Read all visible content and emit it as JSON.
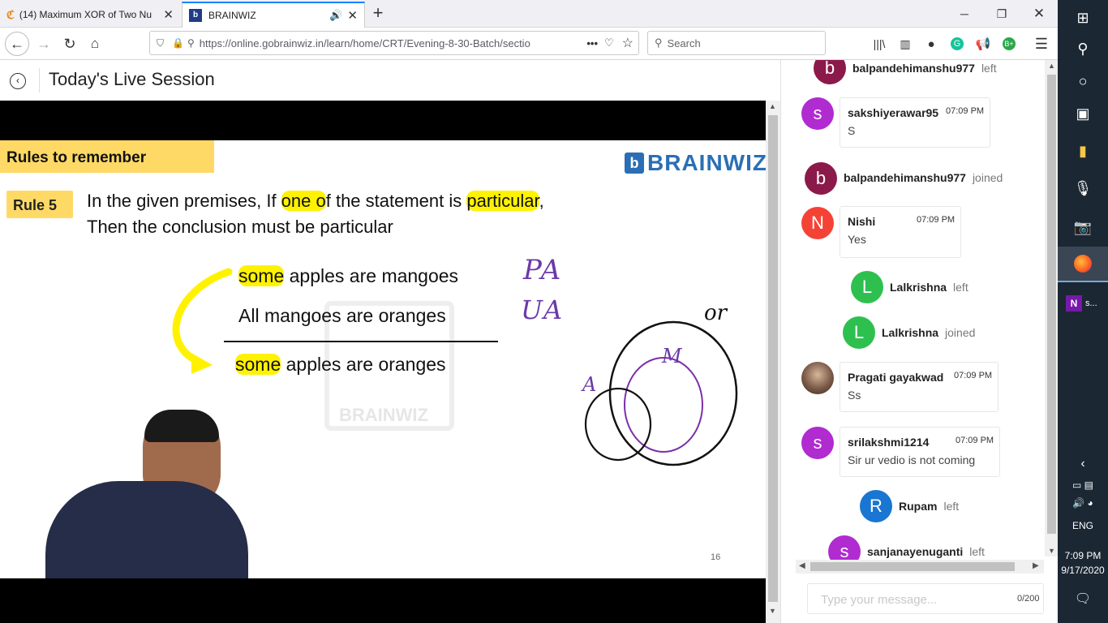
{
  "browser": {
    "tabs": [
      {
        "title": "(14) Maximum XOR of Two Nu"
      },
      {
        "title": "BRAINWIZ"
      }
    ],
    "url": "https://online.gobrainwiz.in/learn/home/CRT/Evening-8-30-Batch/sectio",
    "search_placeholder": "Search"
  },
  "page": {
    "title": "Today's Live Session"
  },
  "slide": {
    "header": "Rules to remember",
    "logo": "BRAINWIZ",
    "rule_badge": "Rule 5",
    "rule_line1_pre": "In the given premises, If ",
    "rule_line1_hl1": "one o",
    "rule_line1_mid": "f the statement is ",
    "rule_line1_hl2": "particular",
    "rule_line1_end": ",",
    "rule_line2": "Then the conclusion must be particular",
    "premise1_hl": "some",
    "premise1_rest": " apples are mangoes",
    "premise2": "All mangoes are oranges",
    "conclusion_hl": "some",
    "conclusion_rest": " apples are oranges",
    "watermark": "BRAINWIZ",
    "hand_pa": "PA",
    "hand_ua": "UA",
    "hand_or": "or",
    "hand_m": "M",
    "hand_a": "A",
    "page_number": "16"
  },
  "chat": {
    "events": [
      {
        "initial": "b",
        "name": "balpandehimanshu977",
        "status": "left",
        "color": "#8b1a4a"
      },
      {
        "initial": "b",
        "name": "balpandehimanshu977",
        "status": "joined",
        "color": "#8b1a4a"
      },
      {
        "initial": "L",
        "name": "Lalkrishna",
        "status": "left",
        "color": "#2ec04f"
      },
      {
        "initial": "L",
        "name": "Lalkrishna",
        "status": "joined",
        "color": "#2ec04f"
      },
      {
        "initial": "R",
        "name": "Rupam",
        "status": "left",
        "color": "#1976d2"
      },
      {
        "initial": "s",
        "name": "sanjanayenuganti",
        "status": "left",
        "color": "#b02bd0"
      }
    ],
    "messages": [
      {
        "initial": "s",
        "name": "sakshiyerawar95",
        "time": "07:09 PM",
        "text": "S",
        "color": "#b02bd0"
      },
      {
        "initial": "N",
        "name": "Nishi",
        "time": "07:09 PM",
        "text": "Yes",
        "color": "#f44336"
      },
      {
        "initial": "",
        "name": "Pragati gayakwad",
        "time": "07:09 PM",
        "text": "Ss",
        "color": "#7a5a48"
      },
      {
        "initial": "s",
        "name": "srilakshmi1214",
        "time": "07:09 PM",
        "text": "Sir ur vedio is not coming",
        "color": "#b02bd0"
      }
    ],
    "input_placeholder": "Type your message...",
    "char_count": "0/200"
  },
  "taskbar": {
    "onenote_label": "s...",
    "lang": "ENG",
    "time": "7:09 PM",
    "date": "9/17/2020"
  },
  "colors": {
    "highlight": "#fff200",
    "slide_header_bg": "#ffd966",
    "logo_blue": "#2a6fb5",
    "taskbar_bg": "#1b2733"
  }
}
